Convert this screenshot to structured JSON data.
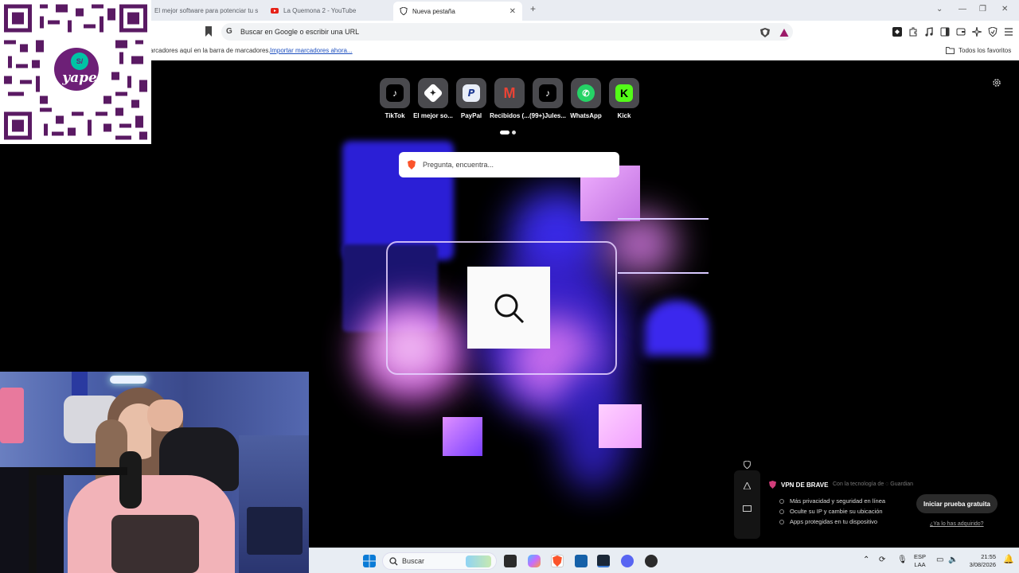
{
  "tabs": [
    {
      "label": "El mejor software para potenciar tu s",
      "active": false
    },
    {
      "label": "La Quemona 2 - YouTube",
      "active": false
    },
    {
      "label": "Nueva pestaña",
      "active": true
    }
  ],
  "omnibox": {
    "placeholder": "Buscar en Google o escribir una URL"
  },
  "bookmarks_bar": {
    "text": "arcadores aquí en la barra de marcadores.",
    "import_link": "Importar marcadores ahora...",
    "all_favorites": "Todos los favoritos"
  },
  "shortcuts": [
    {
      "label": "TikTok",
      "icon": "tiktok-icon"
    },
    {
      "label": "El mejor so...",
      "icon": "gift-icon"
    },
    {
      "label": "PayPal",
      "icon": "paypal-icon"
    },
    {
      "label": "Recibidos (...",
      "icon": "gmail-icon"
    },
    {
      "label": "(99+)Jules...",
      "icon": "tiktok-icon"
    },
    {
      "label": "WhatsApp",
      "icon": "whatsapp-icon"
    },
    {
      "label": "Kick",
      "icon": "kick-icon"
    }
  ],
  "search": {
    "placeholder": "Pregunta, encuentra..."
  },
  "vpn": {
    "title": "VPN DE BRAVE",
    "powered_by": "Con la tecnología de",
    "powered_brand": "Guardian",
    "features": [
      "Más privacidad y seguridad en línea",
      "Oculte su IP y cambie su ubicación",
      "Apps protegidas en tu dispositivo"
    ],
    "cta": "Iniciar prueba gratuita",
    "link": "¿Ya lo has adquirido?"
  },
  "qr_overlay": {
    "brand": "yape",
    "coin": "S/"
  },
  "taskbar": {
    "search_label": "Buscar",
    "lang_top": "ESP",
    "lang_bottom": "LAA",
    "time": "21:55",
    "date": "3/08/2026"
  },
  "colors": {
    "accent_brave": "#fb542b",
    "yape_purple": "#6d2077",
    "yape_teal": "#00c3a5"
  }
}
